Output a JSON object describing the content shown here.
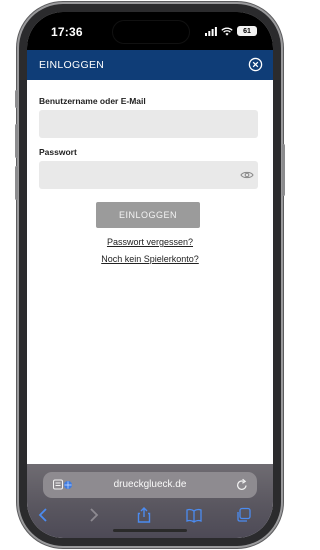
{
  "status_bar": {
    "time": "17:36",
    "battery": "61"
  },
  "header": {
    "title": "EINLOGGEN",
    "background_color": "#0f3d77"
  },
  "login_form": {
    "username_label": "Benutzername oder E-Mail",
    "username_value": "",
    "username_placeholder": "",
    "password_label": "Passwort",
    "password_value": "",
    "password_placeholder": "",
    "submit_label": "EINLOGGEN",
    "forgot_password_link": "Passwort vergessen?",
    "no_account_link": "Noch kein Spielerkonto?"
  },
  "browser": {
    "url": "drueckglueck.de",
    "toolbar_icons": [
      "back-icon",
      "forward-icon",
      "share-icon",
      "bookmarks-icon",
      "tabs-icon"
    ]
  },
  "icons": {
    "close": "close-circle-icon",
    "password_toggle": "eye-icon",
    "page_menu": "page-menu-icon",
    "reload": "reload-icon"
  }
}
